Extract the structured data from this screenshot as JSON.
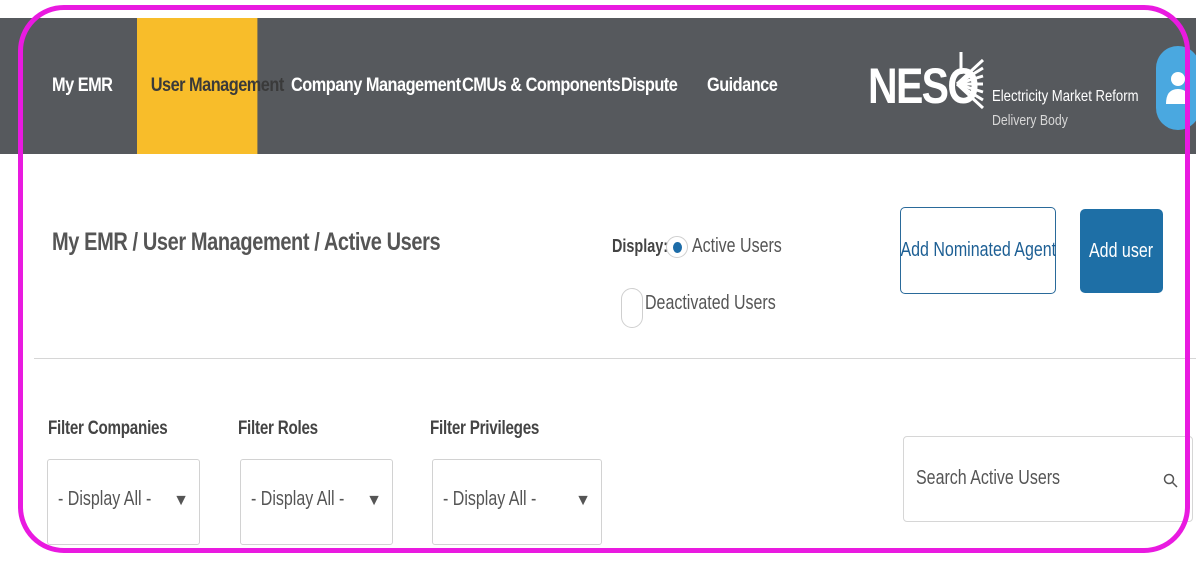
{
  "nav": {
    "items": [
      {
        "label": "My EMR",
        "active": false
      },
      {
        "label": "User Management",
        "active": true
      },
      {
        "label": "Company Management",
        "active": false
      },
      {
        "label": "CMUs & Components",
        "active": false
      },
      {
        "label": "Dispute",
        "active": false
      },
      {
        "label": "Guidance",
        "active": false
      }
    ],
    "active_color": "#f8bd2a",
    "bar_color": "#56595d"
  },
  "brand": {
    "word": "NESO",
    "line1": "Electricity Market Reform",
    "line2": "Delivery Body",
    "icon": "neso-logo-icon"
  },
  "user": {
    "icon": "user-avatar-icon"
  },
  "breadcrumb": "My EMR / User Management / Active Users",
  "display": {
    "label": "Display:",
    "options": [
      {
        "label": "Active Users",
        "checked": true
      },
      {
        "label": "Deactivated Users",
        "checked": false
      }
    ]
  },
  "actions": {
    "add_agent": "Add Nominated Agent",
    "add_user": "Add user"
  },
  "filters": [
    {
      "label": "Filter Companies",
      "value": "- Display All -"
    },
    {
      "label": "Filter Roles",
      "value": "- Display All -"
    },
    {
      "label": "Filter Privileges",
      "value": "- Display All -"
    }
  ],
  "search": {
    "placeholder": "Search Active Users",
    "icon": "search-icon"
  },
  "colors": {
    "primary": "#1e6fa6",
    "frame": "#e91ae0"
  }
}
